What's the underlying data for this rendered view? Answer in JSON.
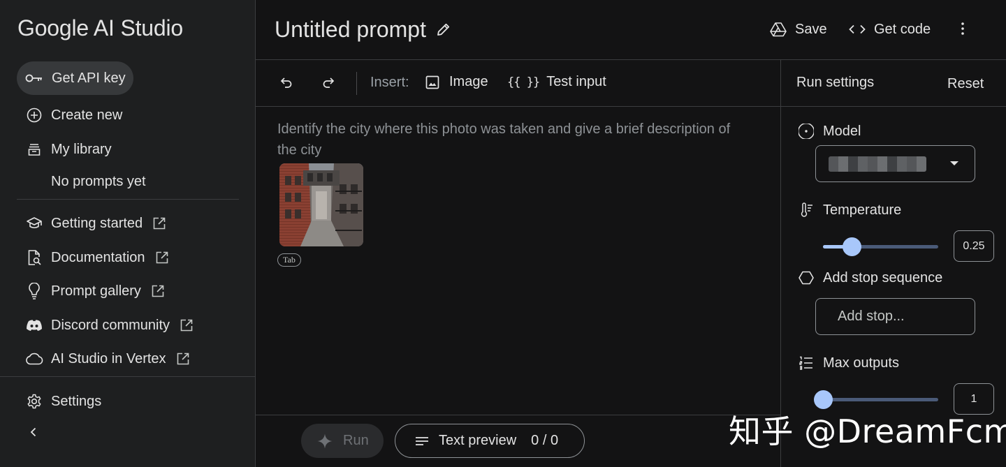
{
  "sidebar": {
    "brand": "Google AI Studio",
    "api_key_label": "Get API key",
    "create_new": "Create new",
    "my_library": "My library",
    "no_prompts": "No prompts yet",
    "links": [
      {
        "label": "Getting started",
        "icon": "school-icon"
      },
      {
        "label": "Documentation",
        "icon": "doc-search-icon"
      },
      {
        "label": "Prompt gallery",
        "icon": "lightbulb-icon"
      },
      {
        "label": "Discord community",
        "icon": "discord-icon"
      },
      {
        "label": "AI Studio in Vertex",
        "icon": "cloud-icon"
      }
    ],
    "settings": "Settings",
    "collapse_icon": "chevron-left-icon"
  },
  "header": {
    "title": "Untitled prompt",
    "save_label": "Save",
    "get_code_label": "Get code"
  },
  "toolbar": {
    "insert_label": "Insert:",
    "image_label": "Image",
    "test_input_braces": "{{ }}",
    "test_input_label": "Test input"
  },
  "editor": {
    "prompt_text": "Identify the city where this photo was taken and give a brief description of the city",
    "attachment_tag": "Tab"
  },
  "footer": {
    "run_label": "Run",
    "text_preview_label": "Text preview",
    "token_count": "0 / 0"
  },
  "run_settings": {
    "title": "Run settings",
    "reset_label": "Reset",
    "model_label": "Model",
    "model_value": "",
    "temperature_label": "Temperature",
    "temperature_value": "0.25",
    "temperature_fraction": 0.25,
    "stop_sequence_label": "Add stop sequence",
    "stop_placeholder": "Add stop...",
    "max_outputs_label": "Max outputs",
    "max_outputs_value": "1",
    "max_outputs_fraction": 0
  },
  "watermark": "知乎 @DreamFcm",
  "colors": {
    "background": "#131314",
    "sidebar": "#1e1f20",
    "accent": "#a8c7fa",
    "text": "#e3e3e3",
    "muted": "#8e9296"
  }
}
